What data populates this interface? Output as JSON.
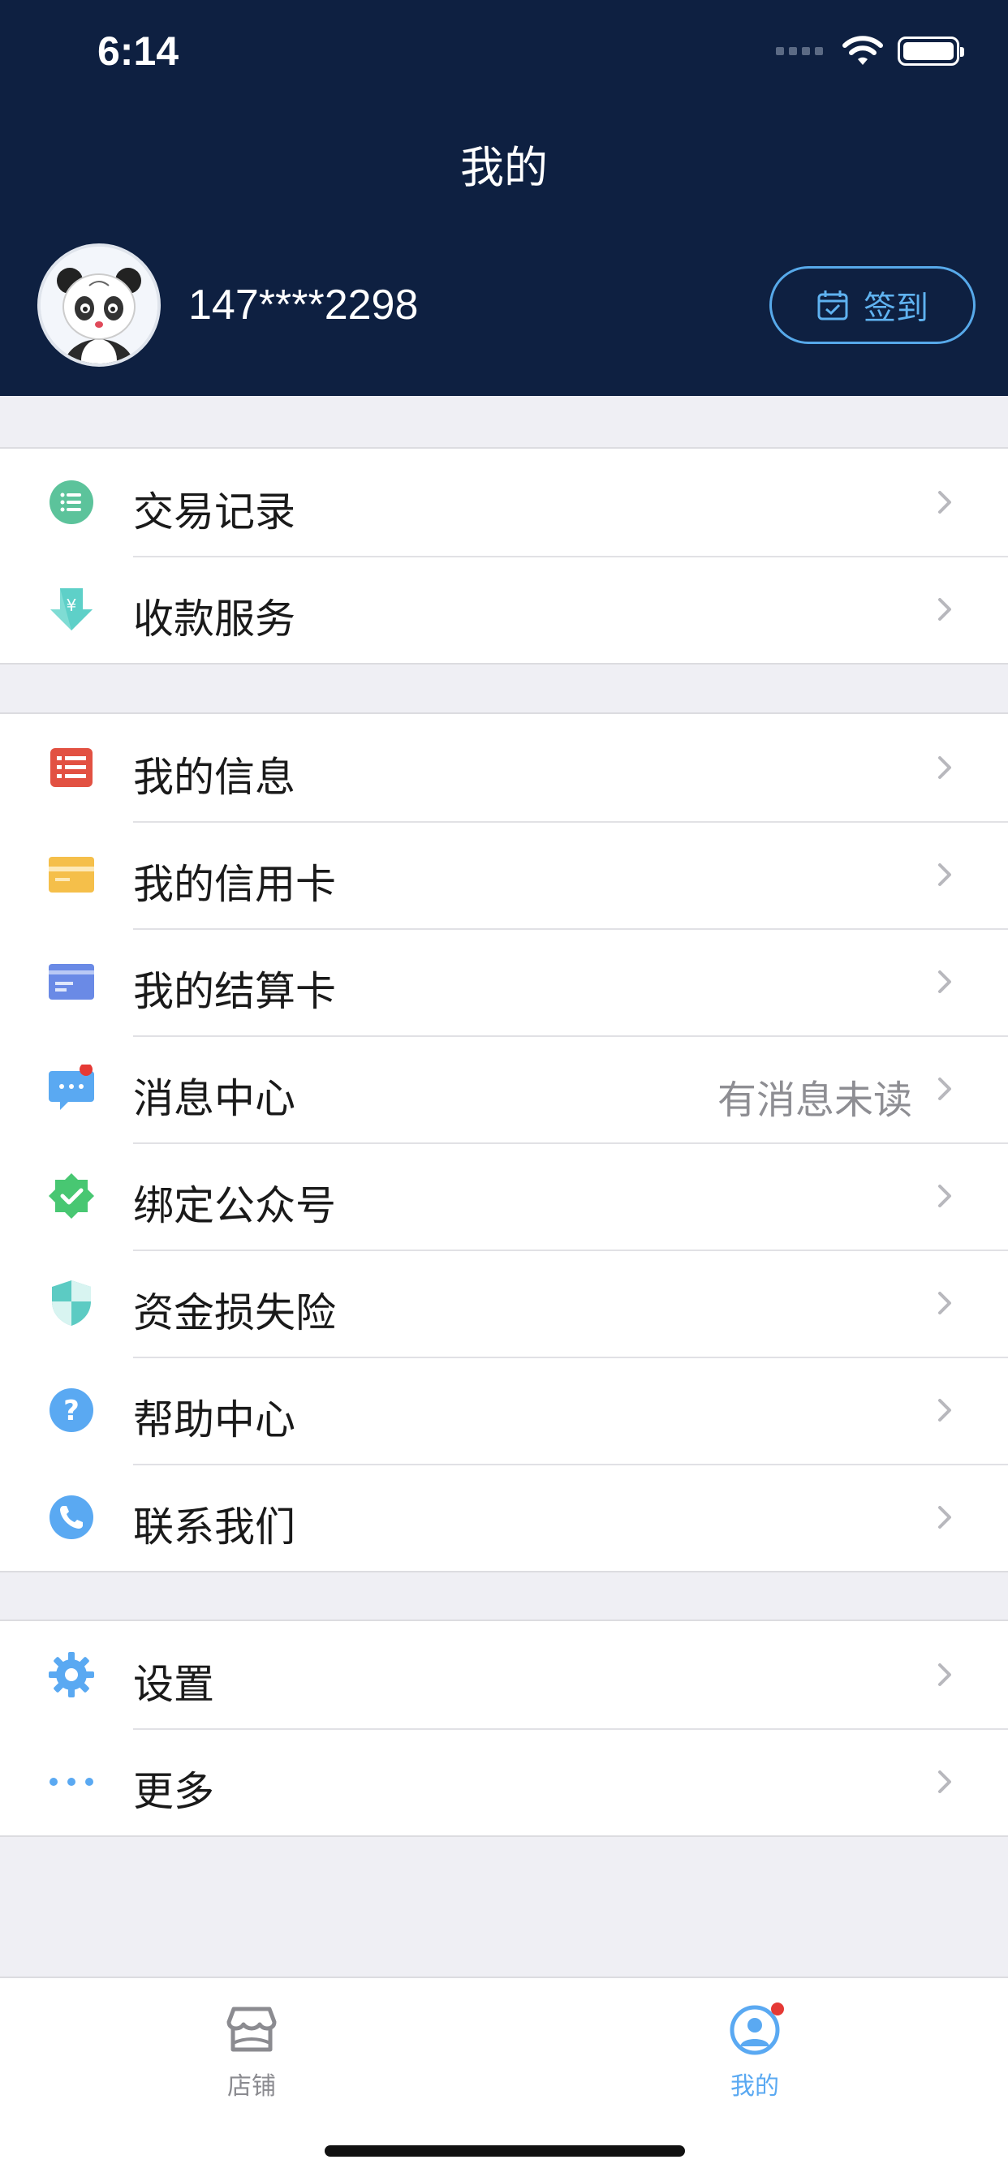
{
  "status_bar": {
    "time": "6:14"
  },
  "header": {
    "title": "我的",
    "phone": "147****2298",
    "signin_label": "签到"
  },
  "groups": [
    {
      "items": [
        {
          "label": "交易记录",
          "icon": "list-icon",
          "color": "#5cc39b"
        },
        {
          "label": "收款服务",
          "icon": "yen-download-icon",
          "color": "#5ed0c8"
        }
      ]
    },
    {
      "items": [
        {
          "label": "我的信息",
          "icon": "info-list-icon",
          "color": "#e25142"
        },
        {
          "label": "我的信用卡",
          "icon": "credit-card-icon",
          "color": "#f5bf4a"
        },
        {
          "label": "我的结算卡",
          "icon": "debit-card-icon",
          "color": "#6a8ae6"
        },
        {
          "label": "消息中心",
          "icon": "message-icon",
          "color": "#5aa9f2",
          "hint": "有消息未读"
        },
        {
          "label": "绑定公众号",
          "icon": "verified-badge-icon",
          "color": "#48c772"
        },
        {
          "label": "资金损失险",
          "icon": "shield-icon",
          "color": "#5ccbc3"
        },
        {
          "label": "帮助中心",
          "icon": "help-icon",
          "color": "#5aa9f2"
        },
        {
          "label": "联系我们",
          "icon": "phone-icon",
          "color": "#5aa9f2"
        }
      ]
    },
    {
      "items": [
        {
          "label": "设置",
          "icon": "gear-icon",
          "color": "#5aa9f2"
        },
        {
          "label": "更多",
          "icon": "more-dots-icon",
          "color": "#5aa9f2"
        }
      ]
    }
  ],
  "tabbar": {
    "tabs": [
      {
        "label": "店铺",
        "icon": "store-icon",
        "active": false
      },
      {
        "label": "我的",
        "icon": "profile-icon",
        "active": true
      }
    ]
  },
  "colors": {
    "header_bg": "#0e2041",
    "accent": "#5aa9f2",
    "badge": "#e53935"
  }
}
